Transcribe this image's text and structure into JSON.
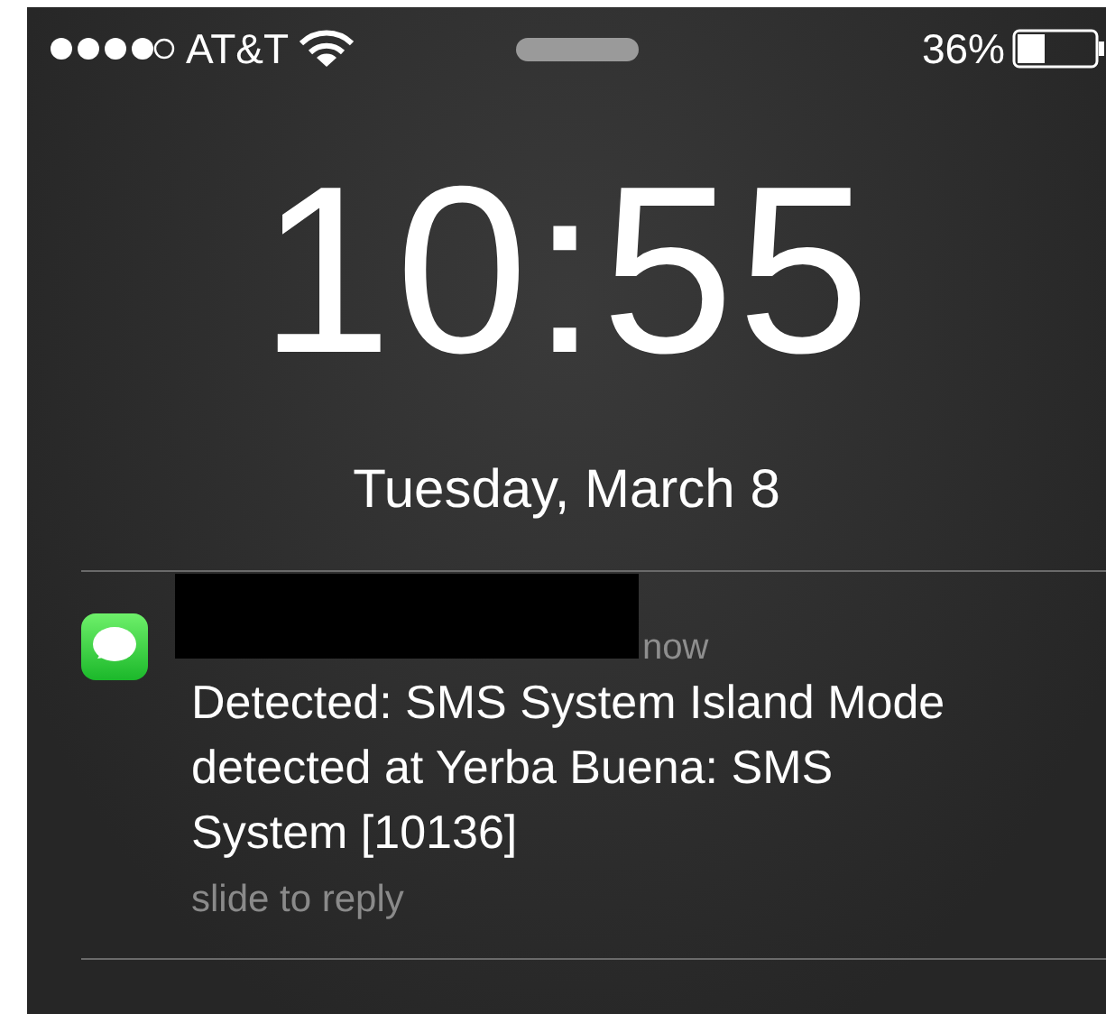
{
  "status_bar": {
    "carrier": "AT&T",
    "battery": "36%"
  },
  "lock_screen": {
    "time": "10:55",
    "date": "Tuesday, March 8"
  },
  "notifications": [
    {
      "time": "now",
      "message": "Detected: SMS System Island Mode detected at Yerba Buena: SMS System [10136]",
      "action": "slide to reply"
    }
  ]
}
